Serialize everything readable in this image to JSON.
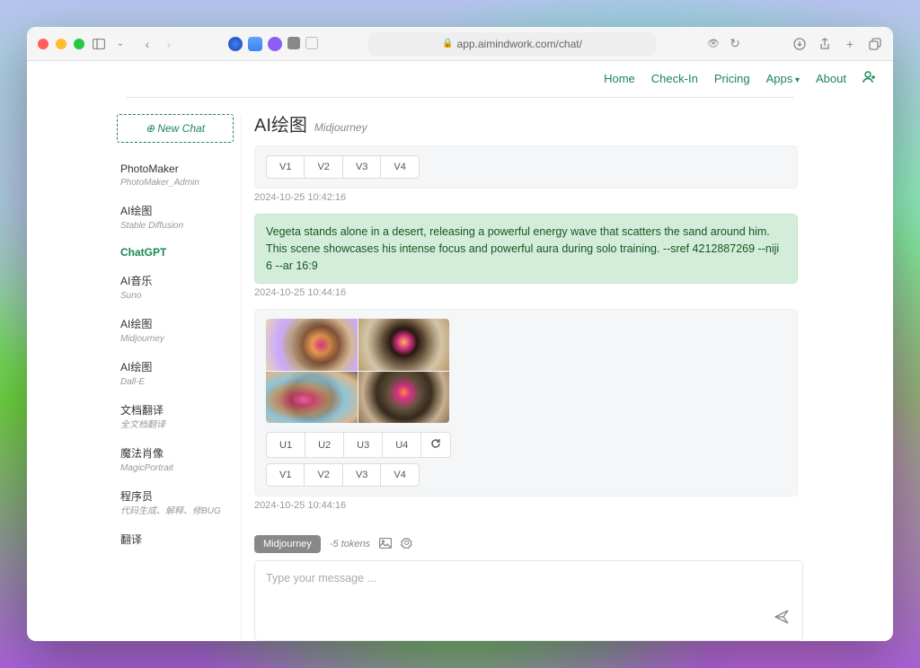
{
  "browser": {
    "url": "app.aimindwork.com/chat/"
  },
  "nav": {
    "home": "Home",
    "checkin": "Check-In",
    "pricing": "Pricing",
    "apps": "Apps",
    "about": "About"
  },
  "sidebar": {
    "new_chat": "New Chat",
    "items": [
      {
        "title": "PhotoMaker",
        "subtitle": "PhotoMaker_Admin"
      },
      {
        "title": "AI绘图",
        "subtitle": "Stable Diffusion"
      },
      {
        "title": "ChatGPT",
        "subtitle": ""
      },
      {
        "title": "AI音乐",
        "subtitle": "Suno"
      },
      {
        "title": "AI绘图",
        "subtitle": "Midjourney"
      },
      {
        "title": "AI绘图",
        "subtitle": "Dall-E"
      },
      {
        "title": "文档翻译",
        "subtitle": "全文档翻译"
      },
      {
        "title": "魔法肖像",
        "subtitle": "MagicPortrait"
      },
      {
        "title": "程序员",
        "subtitle": "代码生成、解释、修BUG"
      },
      {
        "title": "翻译",
        "subtitle": ""
      }
    ]
  },
  "chat_header": {
    "title": "AI绘图",
    "subtitle": "Midjourney"
  },
  "messages": {
    "v_buttons_1": [
      "V1",
      "V2",
      "V3",
      "V4"
    ],
    "time_1": "2024-10-25 10:42:16",
    "user_prompt": "Vegeta stands alone in a desert, releasing a powerful energy wave that scatters the sand around him. This scene showcases his intense focus and powerful aura during solo training. --sref 4212887269 --niji 6 --ar 16:9",
    "time_2": "2024-10-25 10:44:16",
    "u_buttons": [
      "U1",
      "U2",
      "U3",
      "U4"
    ],
    "v_buttons_2": [
      "V1",
      "V2",
      "V3",
      "V4"
    ],
    "time_3": "2024-10-25 10:44:16"
  },
  "input": {
    "mode": "Midjourney",
    "tokens": "-5 tokens",
    "placeholder": "Type your message ..."
  }
}
